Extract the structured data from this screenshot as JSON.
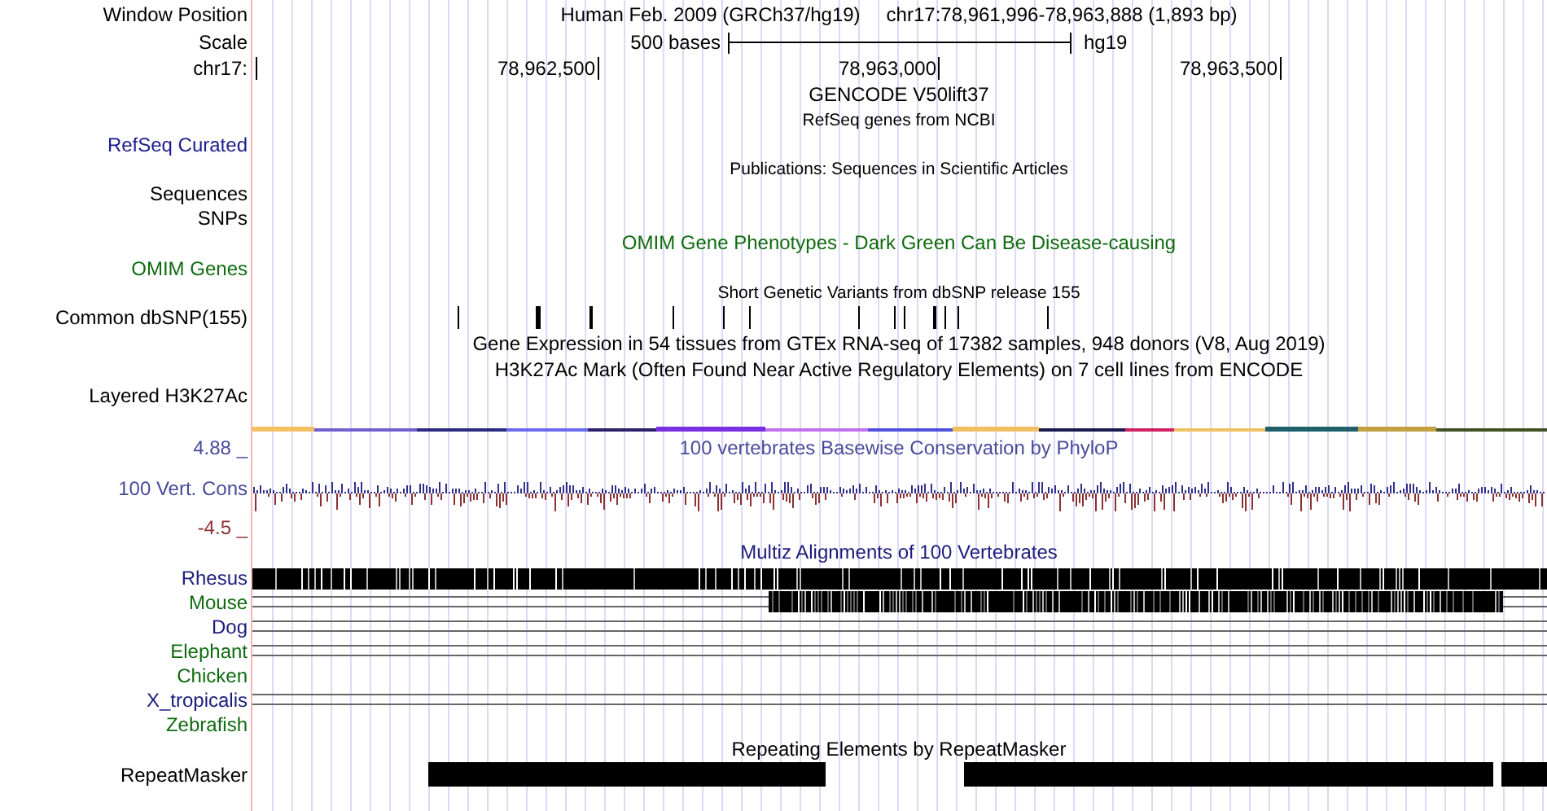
{
  "rows": [
    {
      "kind": "title",
      "label": "Window Position",
      "texts": [
        "Human Feb. 2009 (GRCh37/hg19)",
        "chr17:78,961,996-78,963,888 (1,893 bp)"
      ]
    },
    {
      "kind": "scale",
      "label": "Scale",
      "bar_label": "500 bases",
      "assembly": "hg19"
    },
    {
      "kind": "ruler",
      "label": "chr17:",
      "ticks": [
        "78,962,500",
        "78,963,000",
        "78,963,500"
      ]
    },
    {
      "kind": "text",
      "text": "GENCODE V50lift37"
    },
    {
      "kind": "note",
      "text": "RefSeq genes from NCBI"
    },
    {
      "kind": "label",
      "label": "RefSeq Curated",
      "color": "#1c1c8c"
    },
    {
      "kind": "note",
      "text": "Publications: Sequences in Scientific Articles"
    },
    {
      "kind": "label",
      "label": "Sequences"
    },
    {
      "kind": "label",
      "label": "SNPs"
    },
    {
      "kind": "text",
      "text": "OMIM Gene Phenotypes - Dark Green Can Be Disease-causing",
      "color": "#0f6b0f"
    },
    {
      "kind": "label",
      "label": "OMIM Genes",
      "color": "#0f6b0f"
    },
    {
      "kind": "note",
      "text": "Short Genetic Variants from dbSNP release 155"
    },
    {
      "kind": "snps",
      "label": "Common dbSNP(155)"
    },
    {
      "kind": "text",
      "text": "Gene Expression in 54 tissues from GTEx RNA-seq of 17382 samples, 948 donors (V8, Aug 2019)"
    },
    {
      "kind": "text",
      "text": "H3K27Ac Mark (Often Found Near Active Regulatory Elements) on 7 cell lines from ENCODE"
    },
    {
      "kind": "label",
      "label": "Layered H3K27Ac"
    },
    {
      "kind": "signal"
    },
    {
      "kind": "wiggle",
      "label": "100 Vert. Cons",
      "max": "4.88 _",
      "min": "-4.5 _",
      "title": "100 vertebrates Basewise Conservation by PhyloP",
      "color": "#4a4a9c"
    },
    {
      "kind": "text",
      "text": "Multiz Alignments of 100 Vertebrates",
      "color": "#1c1c7c"
    },
    {
      "kind": "dense",
      "label": "Rhesus",
      "color": "#1c1c7c"
    },
    {
      "kind": "partial",
      "label": "Mouse",
      "color": "#0f6b0f"
    },
    {
      "kind": "lined",
      "label": "Dog",
      "color": "#1c1c7c"
    },
    {
      "kind": "lined",
      "label": "Elephant",
      "color": "#0f6b0f"
    },
    {
      "kind": "blank",
      "label": "Chicken",
      "color": "#0f6b0f"
    },
    {
      "kind": "lined",
      "label": "X_tropicalis",
      "color": "#1c1c7c"
    },
    {
      "kind": "blank",
      "label": "Zebrafish",
      "color": "#0f6b0f"
    },
    {
      "kind": "text",
      "text": "Repeating Elements by RepeatMasker"
    },
    {
      "kind": "repeats",
      "label": "RepeatMasker"
    }
  ]
}
